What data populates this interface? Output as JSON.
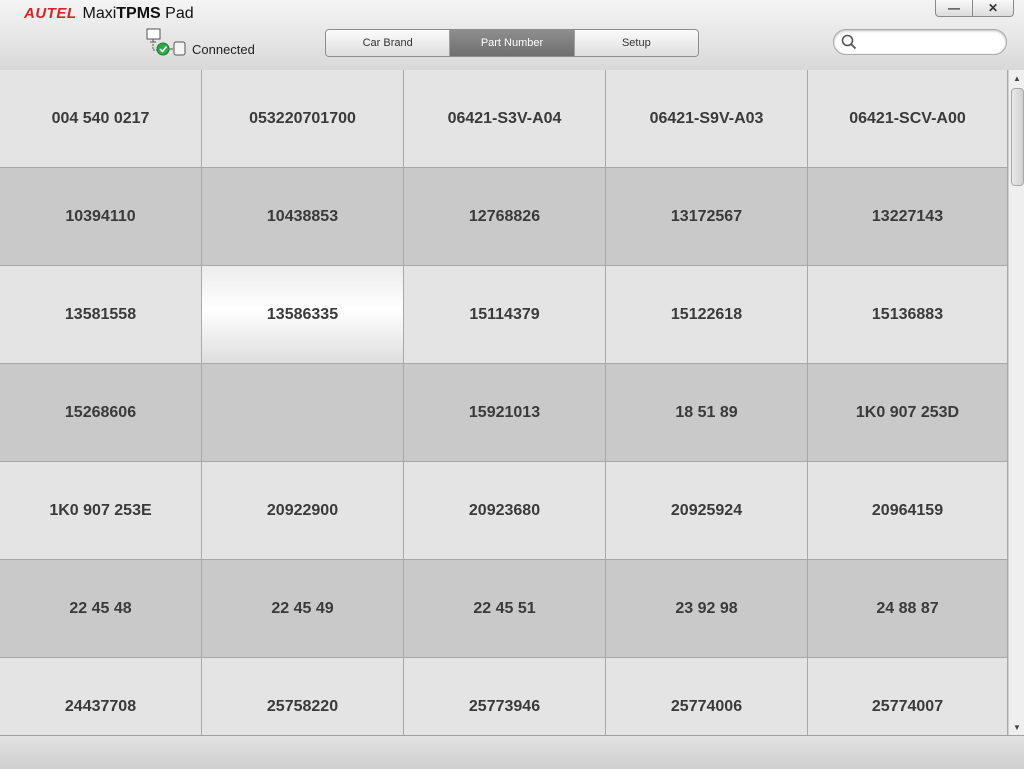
{
  "app": {
    "logo_text": "AUTEL",
    "name_prefix": "Maxi",
    "name_bold": "TPMS",
    "name_suffix": " Pad"
  },
  "window_controls": {
    "minimize": "—",
    "close": "✕"
  },
  "connection": {
    "status": "Connected",
    "icon": "device-connected-icon"
  },
  "tabs": [
    {
      "label": "Car Brand",
      "active": false
    },
    {
      "label": "Part Number",
      "active": true
    },
    {
      "label": "Setup",
      "active": false
    }
  ],
  "search": {
    "value": "",
    "placeholder": "",
    "icon": "search-icon"
  },
  "part_numbers": [
    [
      "004 540 0217",
      "053220701700",
      "06421-S3V-A04",
      "06421-S9V-A03",
      "06421-SCV-A00"
    ],
    [
      "10394110",
      "10438853",
      "12768826",
      "13172567",
      "13227143"
    ],
    [
      "13581558",
      "13586335",
      "15114379",
      "15122618",
      "15136883"
    ],
    [
      "15268606",
      "",
      "15921013",
      "18 51 89",
      "1K0 907 253D"
    ],
    [
      "1K0 907 253E",
      "20922900",
      "20923680",
      "20925924",
      "20964159"
    ],
    [
      "22 45 48",
      "22 45 49",
      "22 45 51",
      "23 92 98",
      "24 88 87"
    ],
    [
      "24437708",
      "25758220",
      "25773946",
      "25774006",
      "25774007"
    ]
  ],
  "selected_part": "13586335",
  "scrollbar": {
    "up_arrow": "▲",
    "down_arrow": "▼"
  },
  "colors": {
    "logo_red": "#d8232a",
    "active_tab": "#7a7a7a",
    "cell_light": "#e4e4e4",
    "cell_dark": "#c9c9c9"
  }
}
